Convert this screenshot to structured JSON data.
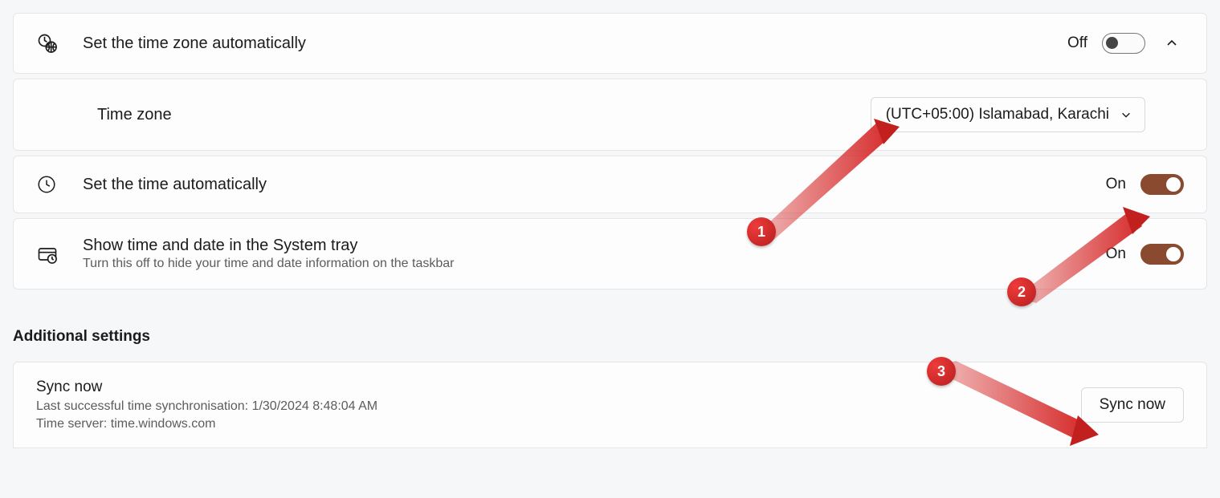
{
  "rows": {
    "auto_tz": {
      "title": "Set the time zone automatically",
      "state_label": "Off",
      "state_on": false
    },
    "timezone": {
      "title": "Time zone",
      "selected": "(UTC+05:00) Islamabad, Karachi"
    },
    "auto_time": {
      "title": "Set the time automatically",
      "state_label": "On",
      "state_on": true
    },
    "tray": {
      "title": "Show time and date in the System tray",
      "subtitle": "Turn this off to hide your time and date information on the taskbar",
      "state_label": "On",
      "state_on": true
    }
  },
  "section_heading": "Additional settings",
  "sync": {
    "title": "Sync now",
    "last_line": "Last successful time synchronisation: 1/30/2024 8:48:04 AM",
    "server_line": "Time server: time.windows.com",
    "button": "Sync now"
  },
  "annotations": {
    "1": "1",
    "2": "2",
    "3": "3"
  }
}
